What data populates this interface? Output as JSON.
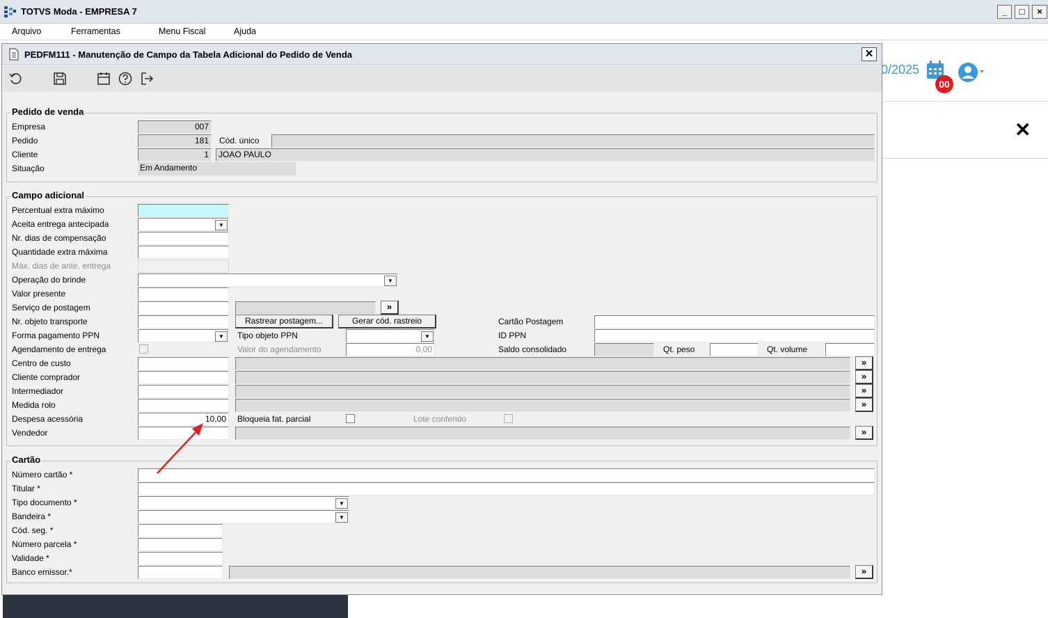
{
  "app": {
    "title": "TOTVS Moda - EMPRESA 7",
    "menu": [
      "Arquivo",
      "Ferramentas",
      "Menu Fiscal",
      "Ajuda"
    ],
    "window_buttons": [
      "_",
      "□",
      "×"
    ]
  },
  "background": {
    "date_fragment": "0/2025",
    "notification_count": "00",
    "close_symbol": "✕"
  },
  "dialog": {
    "title": "PEDFM111 - Manutenção de Campo da Tabela Adicional do Pedido de Venda",
    "toolbar_icons": [
      "undo-icon",
      "save-icon",
      "calendar-icon",
      "help-icon",
      "exit-icon"
    ]
  },
  "pedido": {
    "legend": "Pedido de venda",
    "empresa_label": "Empresa",
    "empresa": "007",
    "pedido_label": "Pedido",
    "pedido": "181",
    "cod_unico_label": "Cód. único",
    "cod_unico": "",
    "cliente_label": "Cliente",
    "cliente_code": "1",
    "cliente_name": "JOAO PAULO",
    "situacao_label": "Situação",
    "situacao": "Em Andamento"
  },
  "campo": {
    "legend": "Campo adicional",
    "percentual_label": "Percentual extra máximo",
    "aceita_label": "Aceita entrega antecipada",
    "nr_dias_label": "Nr. dias de compensação",
    "qtd_extra_label": "Quantidade extra máxima",
    "max_dias_label": "Máx. dias de ante. entrega",
    "operacao_label": "Operação do brinde",
    "valor_presente_label": "Valor presente",
    "servico_label": "Serviço de postagem",
    "nr_objeto_label": "Nr. objeto transporte",
    "rastrear_button": "Rastrear postagem...",
    "gerar_button": "Gerar cód. rastreio",
    "cartao_postagem_label": "Cartão Postagem",
    "forma_pagamento_label": "Forma pagamento PPN",
    "tipo_objeto_label": "Tipo objeto PPN",
    "id_ppn_label": "ID PPN",
    "agendamento_label": "Agendamento de entrega",
    "valor_agendamento_label": "Valor do agendamento",
    "valor_agendamento": "0,00",
    "saldo_label": "Saldo consolidado",
    "qt_peso_label": "Qt. peso",
    "qt_volume_label": "Qt. volume",
    "centro_custo_label": "Centro de custo",
    "cliente_comprador_label": "Cliente comprador",
    "intermediador_label": "Intermediador",
    "medida_rolo_label": "Medida rolo",
    "despesa_label": "Despesa acessória",
    "despesa": "10,00",
    "bloqueia_label": "Bloqueia fat. parcial",
    "lote_label": "Lote conferido",
    "vendedor_label": "Vendedor",
    "zoom_symbol": "»"
  },
  "cartao": {
    "legend": "Cartão",
    "numero_label": "Número cartão *",
    "titular_label": "Titular *",
    "tipo_doc_label": "Tipo documento *",
    "bandeira_label": "Bandeira *",
    "cod_seg_label": "Cód. seg. *",
    "numero_parcela_label": "Número parcela *",
    "validade_label": "Validade *",
    "banco_label": "Banco emissor.*"
  },
  "colors": {
    "annotation_arrow": "#e02020",
    "link_blue": "#3a9ad9",
    "badge_red": "#e11b22",
    "highlight_field": "#c6f5fb"
  }
}
